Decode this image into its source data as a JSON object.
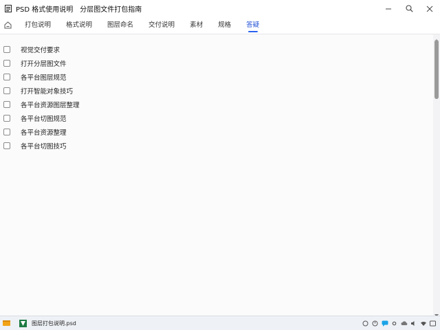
{
  "window": {
    "title_left": "PSD 格式使用说明",
    "title_right": "分层图文件打包指南"
  },
  "tabs": [
    {
      "label": "打包说明",
      "active": false
    },
    {
      "label": "格式说明",
      "active": false
    },
    {
      "label": "图层命名",
      "active": false
    },
    {
      "label": "交付说明",
      "active": false
    },
    {
      "label": "素材",
      "active": false
    },
    {
      "label": "规格",
      "active": false
    },
    {
      "label": "答疑",
      "active": true
    }
  ],
  "checklist": [
    {
      "label": "视觉交付要求",
      "checked": false
    },
    {
      "label": "打开分层图文件",
      "checked": false
    },
    {
      "label": "各平台图层规范",
      "checked": false
    },
    {
      "label": "打开智能对象技巧",
      "checked": false
    },
    {
      "label": "各平台资源图层整理",
      "checked": false
    },
    {
      "label": "各平台切图规范",
      "checked": false
    },
    {
      "label": "各平台资源整理",
      "checked": false
    },
    {
      "label": "各平台切图技巧",
      "checked": false
    }
  ],
  "taskbar": {
    "app_label": "图层打包说明.psd"
  },
  "colors": {
    "accent": "#2a62f0",
    "active_tab_text": "#1f4fd6",
    "scroll_thumb": "#9a9a9a"
  },
  "icons": {
    "app": "psd-file-icon",
    "home": "home-icon",
    "search": "search-icon",
    "minimize": "minimize-icon",
    "close": "close-icon"
  }
}
